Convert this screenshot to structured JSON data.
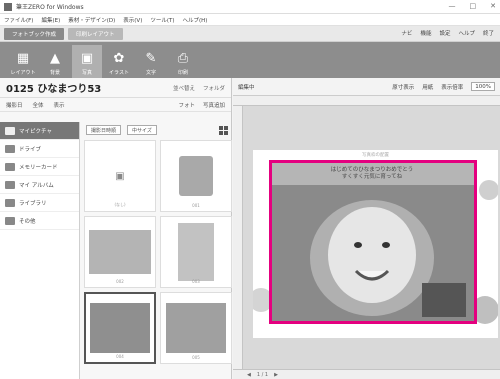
{
  "window": {
    "title": "筆王ZERO for Windows",
    "controls": [
      "—",
      "□",
      "✕"
    ]
  },
  "menu": [
    "ファイル(F)",
    "編集(E)",
    "素材・デザイン(D)",
    "表示(V)",
    "ツール(T)",
    "ヘルプ(H)"
  ],
  "modes": {
    "active": "フォトブック作成",
    "other": "印刷レイアウト"
  },
  "toolbar_right": [
    "ナビ",
    "機能",
    "設定",
    "ヘルプ",
    "終了"
  ],
  "tools": [
    {
      "label": "レイアウト",
      "icon": "layout-icon"
    },
    {
      "label": "背景",
      "icon": "background-icon"
    },
    {
      "label": "写真",
      "icon": "photo-icon",
      "active": true
    },
    {
      "label": "イラスト",
      "icon": "illustration-icon"
    },
    {
      "label": "文字",
      "icon": "text-icon"
    },
    {
      "label": "印刷",
      "icon": "print-icon"
    }
  ],
  "album": {
    "title": "0125 ひなまつり53",
    "actions": [
      "並べ替え",
      "フォルダ"
    ]
  },
  "filters": {
    "left": [
      "撮影日",
      "全体",
      "表示"
    ],
    "right": [
      "フォト",
      "写真追加"
    ]
  },
  "sources": [
    "マイピクチャ",
    "ドライブ",
    "メモリーカード",
    "マイ アルバム",
    "ライブラリ",
    "その他"
  ],
  "photobar": {
    "sort": "撮影日時順",
    "size": "中サイズ"
  },
  "thumbnails": [
    {
      "caption": "(なし)"
    },
    {
      "caption": "001"
    },
    {
      "caption": "002"
    },
    {
      "caption": "003"
    },
    {
      "caption": "004"
    },
    {
      "caption": "005"
    }
  ],
  "editor": {
    "label": "編集中",
    "zoom_label": "表示倍率",
    "zoom_value": "100%",
    "view": "用紙",
    "size_label": "原寸表示",
    "frame_label": "写真枠の配置",
    "caption_line1": "はじめてのひなまつりおめでとう",
    "caption_line2": "すくすく元気に育ってね",
    "page_indicator": "1 / 1"
  },
  "accent_color": "#e4007f"
}
